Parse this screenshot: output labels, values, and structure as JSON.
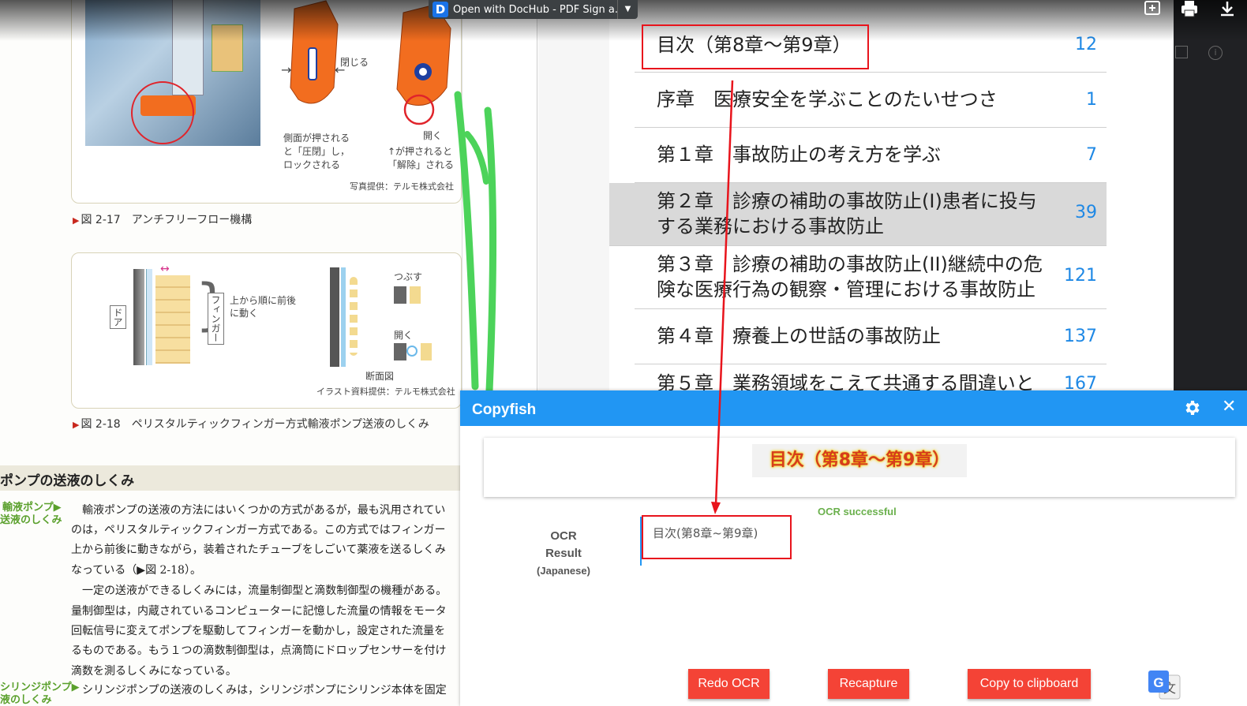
{
  "toolbar": {
    "dochub_label": "Open with DocHub - PDF Sign a...",
    "icons": [
      "add-comment-icon",
      "print-icon",
      "download-icon"
    ]
  },
  "book": {
    "fig1": {
      "label_close": "閉じる",
      "label_open": "開く",
      "desc_left": [
        "側面が押される",
        "と「圧閉」し，",
        "ロックされる"
      ],
      "desc_right": [
        "↑が押されると",
        "「解除」される"
      ],
      "credit": "写真提供：テルモ株式会社",
      "caption": "図 2-17　アンチフリーフロー機構"
    },
    "fig2": {
      "label_door": "ドア",
      "label_finger": "フィンガー",
      "label_motion": [
        "上から順に前後",
        "に動く"
      ],
      "label_crush": "つぶす",
      "label_open": "開く",
      "label_section": "断面図",
      "credit": "イラスト資料提供：テルモ株式会社",
      "caption": "図 2-18　ペリスタルティックフィンガー方式輸液ポンプ送液のしくみ"
    },
    "section_title": "ポンプの送液のしくみ",
    "side_label_1": [
      "輸液ポンプ▶",
      "送液のしくみ"
    ],
    "side_label_2": [
      "シリンジポンプ▶",
      "液のしくみ"
    ],
    "body": [
      "　輸液ポンプの送液の方法にはいくつかの方式があるが，最も汎用されてい",
      "のは，ペリスタルティックフィンガー方式である。この方式ではフィンガー",
      "上から前後に動きながら，装着されたチューブをしごいて薬液を送るしくみ",
      "なっている（▶図 2-18）。",
      "　一定の送液ができるしくみには，流量制御型と滴数制御型の機種がある。",
      "量制御型は，内蔵されているコンピューターに記憶した流量の情報をモータ",
      "回転信号に変えてポンプを駆動してフィンガーを動かし，設定された流量を",
      "るものである。もう１つの滴数制御型は，点滴筒にドロップセンサーを付け",
      "滴数を測るしくみになっている。",
      "　シリンジポンプの送液のしくみは，シリンジポンプにシリンジ本体を固定"
    ]
  },
  "toc": {
    "rows": [
      {
        "text": "目次（第8章〜第9章）",
        "page": "12"
      },
      {
        "text": "序章　医療安全を学ぶことのたいせつさ",
        "page": "1"
      },
      {
        "text": "第１章　事故防止の考え方を学ぶ",
        "page": "7"
      },
      {
        "text_l1": "第２章　診療の補助の事故防止(I)患者に投与",
        "text_l2": "する業務における事故防止",
        "page": "39"
      },
      {
        "text_l1": "第３章　診療の補助の事故防止(II)継続中の危",
        "text_l2": "険な医療行為の観察・管理における事故防止",
        "page": "121"
      },
      {
        "text": "第４章　療養上の世話の事故防止",
        "page": "137"
      },
      {
        "text": "第５章　業務領域をこえて共通する間違いと",
        "page": "167"
      }
    ]
  },
  "copyfish": {
    "title": "Copyfish",
    "captured_text": "目次（第8章〜第9章）",
    "status": "OCR successful",
    "ocr_label": "OCR Result",
    "ocr_lang": "(Japanese)",
    "ocr_text": "目次(第8章~第9章)",
    "buttons": {
      "redo": "Redo OCR",
      "recapture": "Recapture",
      "copy": "Copy to clipboard"
    }
  },
  "colors": {
    "accent": "#2196f3",
    "button": "#f44336",
    "annotation": "#e8141c",
    "toc_page": "#1e88e5",
    "status_ok": "#6ab04c"
  }
}
